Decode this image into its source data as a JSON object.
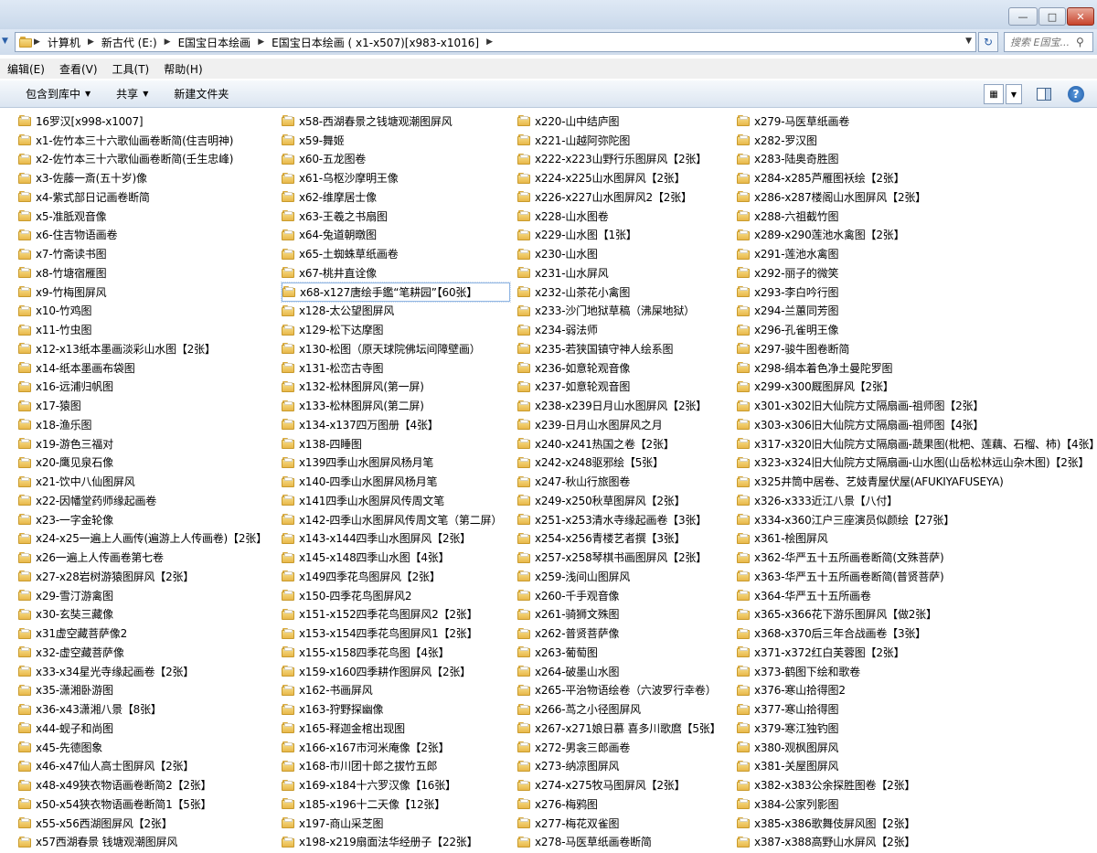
{
  "window": {
    "min_glyph": "—",
    "max_glyph": "□",
    "close_glyph": "✕"
  },
  "address": {
    "crumbs": [
      "计算机",
      "新古代 (E:)",
      "E国宝日本绘画",
      "E国宝日本绘画 ( x1-x507)[x983-x1016]"
    ],
    "refresh_glyph": "↻",
    "search_placeholder": "搜索 E国宝..."
  },
  "menu": [
    "编辑(E)",
    "查看(V)",
    "工具(T)",
    "帮助(H)"
  ],
  "commands": {
    "include_library": "包含到库中",
    "share": "共享",
    "new_folder": "新建文件夹"
  },
  "icons": {
    "folder": "folder-icon",
    "back": "back-arrow-icon",
    "refresh": "refresh-icon",
    "search": "search-icon",
    "views": "views-icon",
    "preview_pane": "preview-pane-icon",
    "help": "help-icon"
  },
  "selected_item": "x68-x127唐绘手鑑“笔耕园”【60张】",
  "columns": [
    [
      "16罗汉[x998-x1007]",
      "x1-佐竹本三十六歌仙画卷断简(住吉明神)",
      "x2-佐竹本三十六歌仙画卷断简(壬生忠峰)",
      "x3-佐藤一斎(五十岁)像",
      "x4-紫式部日记画卷断简",
      "x5-准胝观音像",
      "x6-住吉物语画卷",
      "x7-竹斋读书图",
      "x8-竹塘宿雁图",
      "x9-竹梅图屏风",
      "x10-竹鸡图",
      "x11-竹虫图",
      "x12-x13纸本墨画淡彩山水图【2张】",
      "x14-纸本墨画布袋图",
      "x16-远浦归帆图",
      "x17-猿图",
      "x18-渔乐图",
      "x19-游色三福对",
      "x20-鹰见泉石像",
      "x21-饮中八仙图屏风",
      "x22-因幡堂药师缘起画卷",
      "x23-一字金轮像",
      "x24-x25一遍上人画传(遍游上人传画卷)【2张】",
      "x26一遍上人传画卷第七卷",
      "x27-x28岩树游猿图屏风【2张】",
      "x29-雪汀游禽图",
      "x30-玄奘三藏像",
      "x31虚空藏菩萨像2",
      "x32-虚空藏菩萨像",
      "x33-x34星光寺缘起画卷【2张】",
      "x35-潇湘卧游图",
      "x36-x43潇湘八景【8张】",
      "x44-蚬子和尚图",
      "x45-先德图象",
      "x46-x47仙人高士图屏风【2张】",
      "x48-x49狭衣物语画卷断简2【2张】",
      "x50-x54狭衣物语画卷断简1【5张】",
      "x55-x56西湖图屏风【2张】",
      "x57西湖春景 钱塘观潮图屏风"
    ],
    [
      "x58-西湖春景之钱塘观潮图屏风",
      "x59-舞姬",
      "x60-五龙图卷",
      "x61-乌枢沙摩明王像",
      "x62-维摩居士像",
      "x63-王羲之书扇图",
      "x64-兔道朝暾图",
      "x65-土蜘蛛草纸画卷",
      "x67-桃井直诠像",
      "x68-x127唐绘手鑑“笔耕园”【60张】",
      "x128-太公望图屏风",
      "x129-松下达摩图",
      "x130-松图（原天球院佛坛间障壁画）",
      "x131-松峦古寺图",
      "x132-松林图屏风(第一屏)",
      "x133-松林图屏风(第二屏)",
      "x134-x137四万图册【4张】",
      "x138-四睡图",
      "x139四季山水图屏风杨月笔",
      "x140-四季山水图屏风杨月笔",
      "x141四季山水图屏风传周文笔",
      "x142-四季山水图屏风传周文笔（第二屏）",
      "x143-x144四季山水图屏风【2张】",
      "x145-x148四季山水图【4张】",
      "x149四季花鸟图屏风【2张】",
      "x150-四季花鸟图屏风2",
      "x151-x152四季花鸟图屏风2【2张】",
      "x153-x154四季花鸟图屏风1【2张】",
      "x155-x158四季花鸟图【4张】",
      "x159-x160四季耕作图屏风【2张】",
      "x162-书画屏风",
      "x163-狩野探幽像",
      "x165-释迦金棺出现图",
      "x166-x167市河米庵像【2张】",
      "x168-市川团十郎之拔竹五郎",
      "x169-x184十六罗汉像【16张】",
      "x185-x196十二天像【12张】",
      "x197-商山采芝图",
      "x198-x219扇面法华经册子【22张】"
    ],
    [
      "x220-山中结庐图",
      "x221-山越阿弥陀图",
      "x222-x223山野行乐图屏风【2张】",
      "x224-x225山水图屏风【2张】",
      "x226-x227山水图屏风2【2张】",
      "x228-山水图卷",
      "x229-山水图【1张】",
      "x230-山水图",
      "x231-山水屏风",
      "x232-山茶花小禽图",
      "x233-沙门地狱草稿（沸屎地狱）",
      "x234-弱法师",
      "x235-若狭国镇守神人绘系图",
      "x236-如意轮观音像",
      "x237-如意轮观音图",
      "x238-x239日月山水图屏风【2张】",
      "x239-日月山水图屏风之月",
      "x240-x241热国之卷【2张】",
      "x242-x248驱邪绘【5张】",
      "x247-秋山行旅图卷",
      "x249-x250秋草图屏风【2张】",
      "x251-x253清水寺缘起画卷【3张】",
      "x254-x256青楼艺者撰【3张】",
      "x257-x258琴棋书画图屏风【2张】",
      "x259-浅间山图屏风",
      "x260-千手观音像",
      "x261-骑狮文殊图",
      "x262-普贤菩萨像",
      "x263-葡萄图",
      "x264-破墨山水图",
      "x265-平治物语绘卷（六波罗行幸卷）",
      "x266-茑之小径图屏风",
      "x267-x271娘日慕 喜多川歌麿【5张】",
      "x272-男衾三郎画卷",
      "x273-纳凉图屏风",
      "x274-x275牧马图屏风【2张】",
      "x276-梅鸦图",
      "x277-梅花双雀图",
      "x278-马医草纸画卷断简"
    ],
    [
      "x279-马医草纸画卷",
      "x282-罗汉图",
      "x283-陆奥奇胜图",
      "x284-x285芦雁图袄绘【2张】",
      "x286-x287楼阁山水图屏风【2张】",
      "x288-六祖截竹图",
      "x289-x290莲池水禽图【2张】",
      "x291-莲池水禽图",
      "x292-丽子的微笑",
      "x293-李白吟行图",
      "x294-兰蕙同芳图",
      "x296-孔雀明王像",
      "x297-骏牛图卷断简",
      "x298-绢本着色净土曼陀罗图",
      "x299-x300厩图屏风【2张】",
      "x301-x302旧大仙院方丈隔扇画-祖师图【2张】",
      "x303-x306旧大仙院方丈隔扇画-祖师图【4张】",
      "x317-x320旧大仙院方丈隔扇画-蔬果图(枇杷、莲藕、石榴、柿)【4张】",
      "x323-x324旧大仙院方丈隔扇画-山水图(山岳松林远山杂木图)【2张】",
      "x325井筒中居卷、艺妓青屋伏屋(AFUKIYAFUSEYA)",
      "x326-x333近江八景【八付】",
      "x334-x360江户三座演员似颜绘【27张】",
      "x361-桧图屏风",
      "x362-华严五十五所画卷断简(文殊菩萨)",
      "x363-华严五十五所画卷断简(普贤菩萨)",
      "x364-华严五十五所画卷",
      "x365-x366花下游乐图屏风【做2张】",
      "x368-x370后三年合战画卷【3张】",
      "x371-x372红白芙蓉图【2张】",
      "x373-鹤图下绘和歌卷",
      "x376-寒山拾得图2",
      "x377-寒山拾得图",
      "x379-寒江独钓图",
      "x380-观枫图屏风",
      "x381-关屋图屏风",
      "x382-x383公余探胜图卷【2张】",
      "x384-公家列影图",
      "x385-x386歌舞伎屏风图【2张】",
      "x387-x388高野山水屏风【2张】"
    ]
  ]
}
